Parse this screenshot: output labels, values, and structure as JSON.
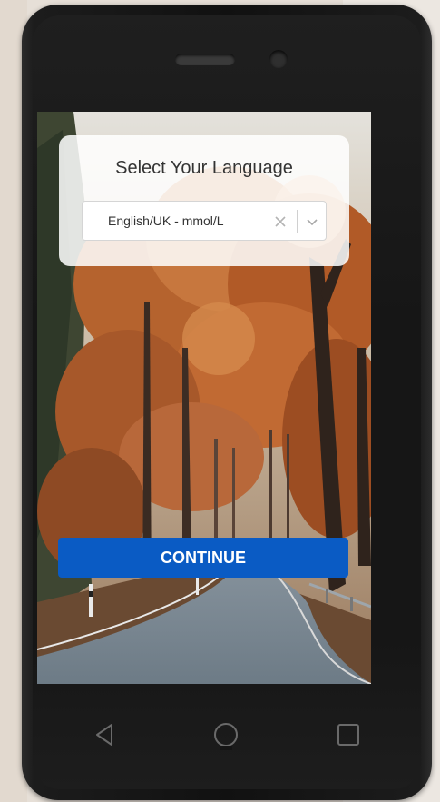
{
  "language_dialog": {
    "title": "Select Your Language",
    "selected_language": "English/UK - mmol/L",
    "clear_icon": "close-icon",
    "dropdown_icon": "chevron-down-icon"
  },
  "actions": {
    "continue_label": "CONTINUE"
  },
  "nav_bar": {
    "back_icon": "triangle-back-icon",
    "home_icon": "circle-home-icon",
    "recents_icon": "square-recents-icon"
  },
  "colors": {
    "primary_button": "#0a5bc4",
    "phone_body": "#151515",
    "background": "#e6dfd7"
  }
}
